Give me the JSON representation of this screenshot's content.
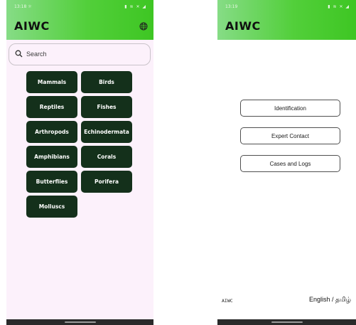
{
  "left_screen": {
    "status_time": "13:18 ☼",
    "status_icons": "▮ ≋ ✕ ◢",
    "app_title": "AIWC",
    "search": {
      "placeholder": "Search"
    },
    "categories": [
      "Mammals",
      "Birds",
      "Reptiles",
      "Fishes",
      "Arthropods",
      "Echinodermata",
      "Amphibians",
      "Corals",
      "Butterflies",
      "Porifera",
      "Molluscs"
    ]
  },
  "right_screen": {
    "status_time": "13:19",
    "status_icons": "▮ ≋ ✕ ◢",
    "app_title": "AIWC",
    "options": [
      "Identification",
      "Expert Contact",
      "Cases and Logs"
    ],
    "footer_brand": "AIWC",
    "footer_language": "English / தமிழ்"
  },
  "colors": {
    "appbar_start": "#86dc86",
    "appbar_end": "#3ec623",
    "category_button": "#14301b",
    "left_background": "#fcf1fb"
  },
  "icons": [
    "globe-icon",
    "search-icon"
  ]
}
